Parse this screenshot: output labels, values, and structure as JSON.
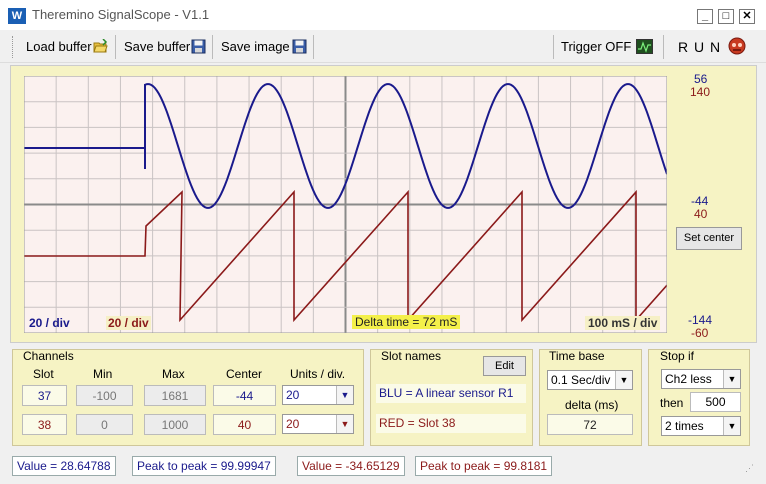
{
  "window": {
    "title": "Theremino SignalScope - V1.1"
  },
  "toolbar": {
    "load_buffer": "Load buffer",
    "save_buffer": "Save buffer",
    "save_image": "Save image",
    "trigger": "Trigger OFF",
    "run": "R U N"
  },
  "scope": {
    "scale_top_blue": "56",
    "scale_top_red": "140",
    "scale_mid_blue": "-44",
    "scale_mid_red": "40",
    "scale_bot_blue": "-144",
    "scale_bot_red": "-60",
    "set_center": "Set center",
    "blue_div": "20 / div",
    "red_div": "20 / div",
    "delta_time": "Delta time = 72 mS",
    "time_div": "100 mS / div",
    "colors": {
      "blue": "#1a1a8c",
      "red": "#8b1a1a",
      "grid": "#c9c3c3",
      "background": "#fbf1ef"
    }
  },
  "channels": {
    "title": "Channels",
    "headers": {
      "slot": "Slot",
      "min": "Min",
      "max": "Max",
      "center": "Center",
      "units": "Units / div."
    },
    "rows": [
      {
        "slot": "37",
        "min": "-100",
        "max": "1681",
        "center": "-44",
        "units": "20"
      },
      {
        "slot": "38",
        "min": "0",
        "max": "1000",
        "center": "40",
        "units": "20"
      }
    ]
  },
  "slot_names": {
    "title": "Slot names",
    "edit": "Edit",
    "blu": "BLU = A linear sensor R1",
    "red": "RED = Slot 38"
  },
  "time_base": {
    "title": "Time base",
    "value": "0.1 Sec/div",
    "delta_label": "delta (ms)",
    "delta_value": "72"
  },
  "stop_if": {
    "title": "Stop if",
    "condition": "Ch2 less",
    "then_label": "then",
    "then_value": "500",
    "times": "2 times"
  },
  "status": {
    "blue_value": "Value = 28.64788",
    "blue_p2p": "Peak to peak = 99.99947",
    "red_value": "Value = -34.65129",
    "red_p2p": "Peak to peak = 99.8181"
  }
}
